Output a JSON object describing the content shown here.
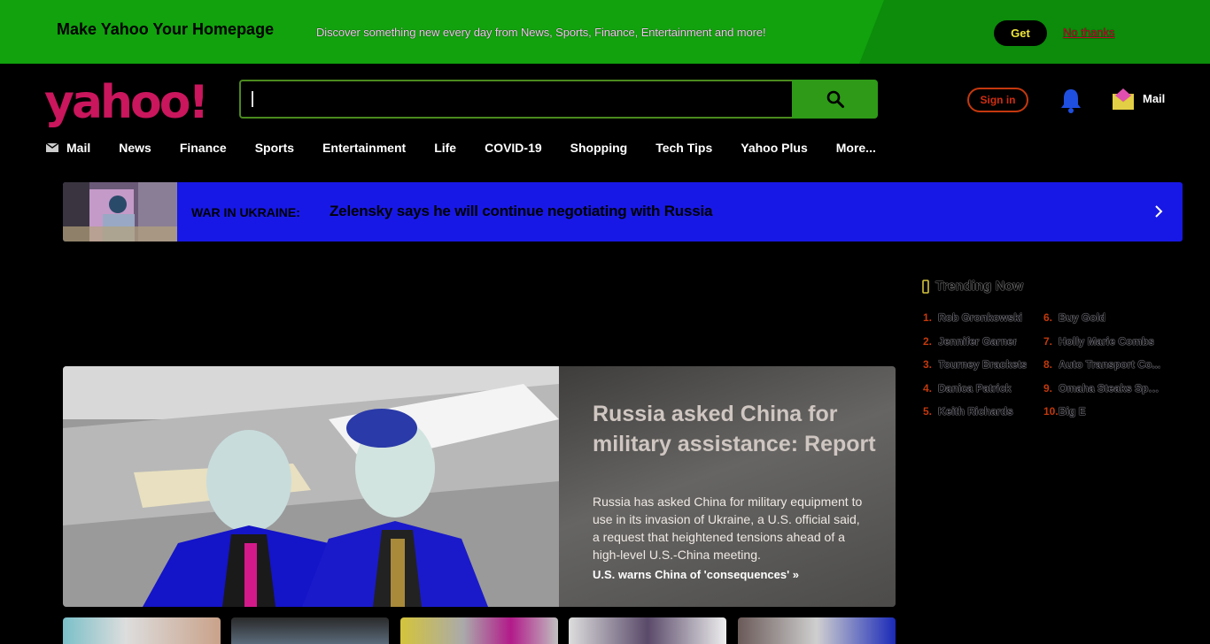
{
  "promo": {
    "title": "Make Yahoo Your Homepage",
    "description": "Discover something new every day from News, Sports, Finance, Entertainment and more!",
    "get_label": "Get",
    "dismiss_label": "No thanks"
  },
  "header": {
    "logo_text": "yahoo!",
    "search": {
      "value": "",
      "icon": "search-icon"
    },
    "signin_label": "Sign in",
    "notifications_icon": "bell-icon",
    "mail_label": "Mail",
    "mail_icon": "mail-envelope-icon"
  },
  "nav": {
    "items": [
      {
        "label": "Mail",
        "icon": "mail-icon"
      },
      {
        "label": "News"
      },
      {
        "label": "Finance"
      },
      {
        "label": "Sports"
      },
      {
        "label": "Entertainment"
      },
      {
        "label": "Life"
      },
      {
        "label": "COVID-19"
      },
      {
        "label": "Shopping"
      },
      {
        "label": "Tech Tips"
      },
      {
        "label": "Yahoo Plus"
      },
      {
        "label": "More..."
      }
    ]
  },
  "breaking": {
    "tag": "WAR IN UKRAINE:",
    "headline": "Zelensky says he will continue negotiating with Russia",
    "color": "#1818e6"
  },
  "trending": {
    "title": "Trending Now",
    "items": [
      {
        "num": "1.",
        "name": "Rob Gronkowski"
      },
      {
        "num": "2.",
        "name": "Jennifer Garner"
      },
      {
        "num": "3.",
        "name": "Tourney Brackets"
      },
      {
        "num": "4.",
        "name": "Danica Patrick"
      },
      {
        "num": "5.",
        "name": "Keith Richards"
      },
      {
        "num": "6.",
        "name": "Buy Gold"
      },
      {
        "num": "7.",
        "name": "Holly Marie Combs"
      },
      {
        "num": "8.",
        "name": "Auto Transport Co..."
      },
      {
        "num": "9.",
        "name": "Omaha Steaks Speci..."
      },
      {
        "num": "10.",
        "name": "Big E"
      }
    ]
  },
  "hero": {
    "title": "Russia asked China for military assistance: Report",
    "description": "Russia has asked China for military equipment to use in its invasion of Ukraine, a U.S. official said, a request that heightened tensions ahead of a high-level U.S.-China meeting.",
    "link": "U.S. warns China of 'consequences' »"
  },
  "colors": {
    "promo_bg": "#11a20d",
    "brand": "#c9165c",
    "search_button": "#2e9a17",
    "accent": "#c2390c"
  }
}
